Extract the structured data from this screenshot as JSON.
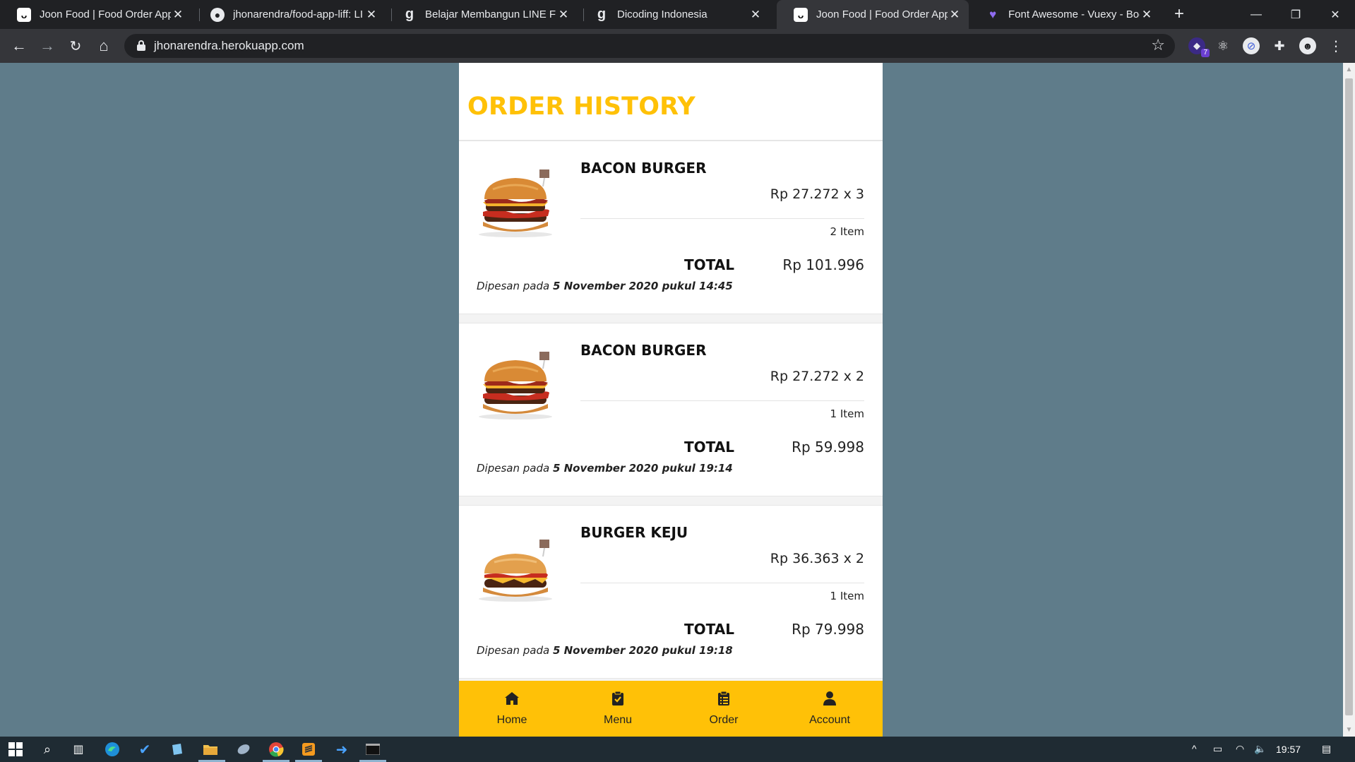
{
  "browser": {
    "tabs": [
      {
        "title": "Joon Food | Food Order App",
        "icon": "joon-food-icon",
        "active": false
      },
      {
        "title": "jhonarendra/food-app-liff: LI",
        "icon": "github-icon",
        "active": false
      },
      {
        "title": "Belajar Membangun LINE Fro",
        "icon": "dicoding-icon",
        "active": false
      },
      {
        "title": "Dicoding Indonesia",
        "icon": "dicoding-icon",
        "active": false
      },
      {
        "title": "Joon Food | Food Order App",
        "icon": "joon-food-icon",
        "active": true
      },
      {
        "title": "Font Awesome - Vuexy - Boo",
        "icon": "vuexy-icon",
        "active": false
      }
    ],
    "url": "jhonarendra.herokuapp.com",
    "extension_badge": "7"
  },
  "page": {
    "title": "ORDER HISTORY"
  },
  "orders": [
    {
      "name": "BACON BURGER",
      "price_qty": "Rp 27.272 x 3",
      "count": "2 Item",
      "total_label": "TOTAL",
      "total": "Rp 101.996",
      "date_prefix": "Dipesan pada",
      "date": "5 November 2020 pukul 14:45",
      "image": "bacon-burger"
    },
    {
      "name": "BACON BURGER",
      "price_qty": "Rp 27.272 x 2",
      "count": "1 Item",
      "total_label": "TOTAL",
      "total": "Rp 59.998",
      "date_prefix": "Dipesan pada",
      "date": "5 November 2020 pukul 19:14",
      "image": "bacon-burger"
    },
    {
      "name": "BURGER KEJU",
      "price_qty": "Rp 36.363 x 2",
      "count": "1 Item",
      "total_label": "TOTAL",
      "total": "Rp 79.998",
      "date_prefix": "Dipesan pada",
      "date": "5 November 2020 pukul 19:18",
      "image": "cheese-burger"
    }
  ],
  "bottom_nav": [
    {
      "label": "Home",
      "icon": "home-icon"
    },
    {
      "label": "Menu",
      "icon": "clipboard-check-icon"
    },
    {
      "label": "Order",
      "icon": "clipboard-list-icon"
    },
    {
      "label": "Account",
      "icon": "user-icon"
    }
  ],
  "taskbar": {
    "time": "19:57"
  },
  "colors": {
    "accent": "#ffc107",
    "page_background": "#5f7c8a",
    "browser_dark": "#202124"
  }
}
